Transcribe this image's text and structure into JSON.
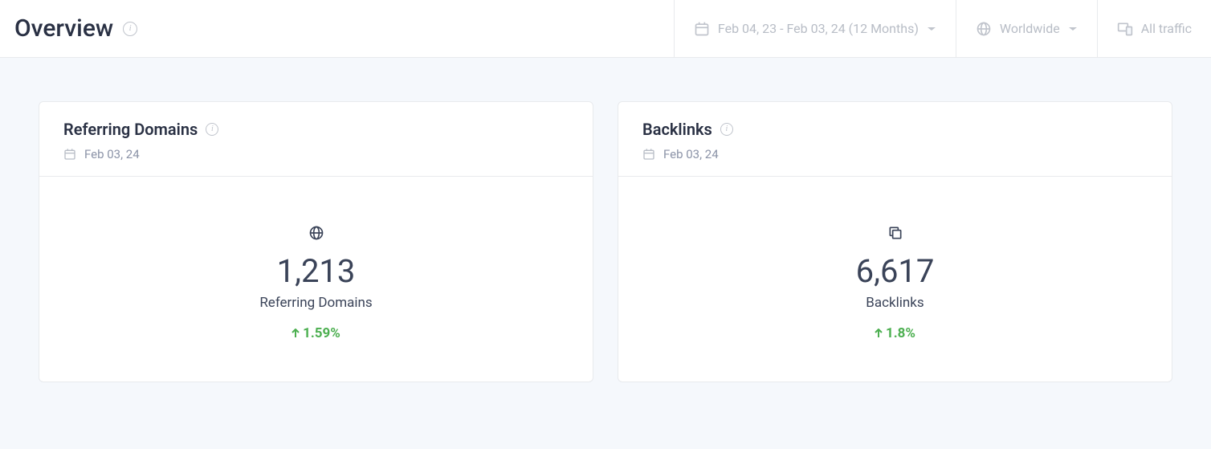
{
  "header": {
    "title": "Overview",
    "dateRange": "Feb 04, 23 - Feb 03, 24 (12 Months)",
    "region": "Worldwide",
    "traffic": "All traffic"
  },
  "cards": {
    "referring": {
      "title": "Referring Domains",
      "date": "Feb 03, 24",
      "value": "1,213",
      "label": "Referring Domains",
      "change": "1.59%"
    },
    "backlinks": {
      "title": "Backlinks",
      "date": "Feb 03, 24",
      "value": "6,617",
      "label": "Backlinks",
      "change": "1.8%"
    }
  }
}
